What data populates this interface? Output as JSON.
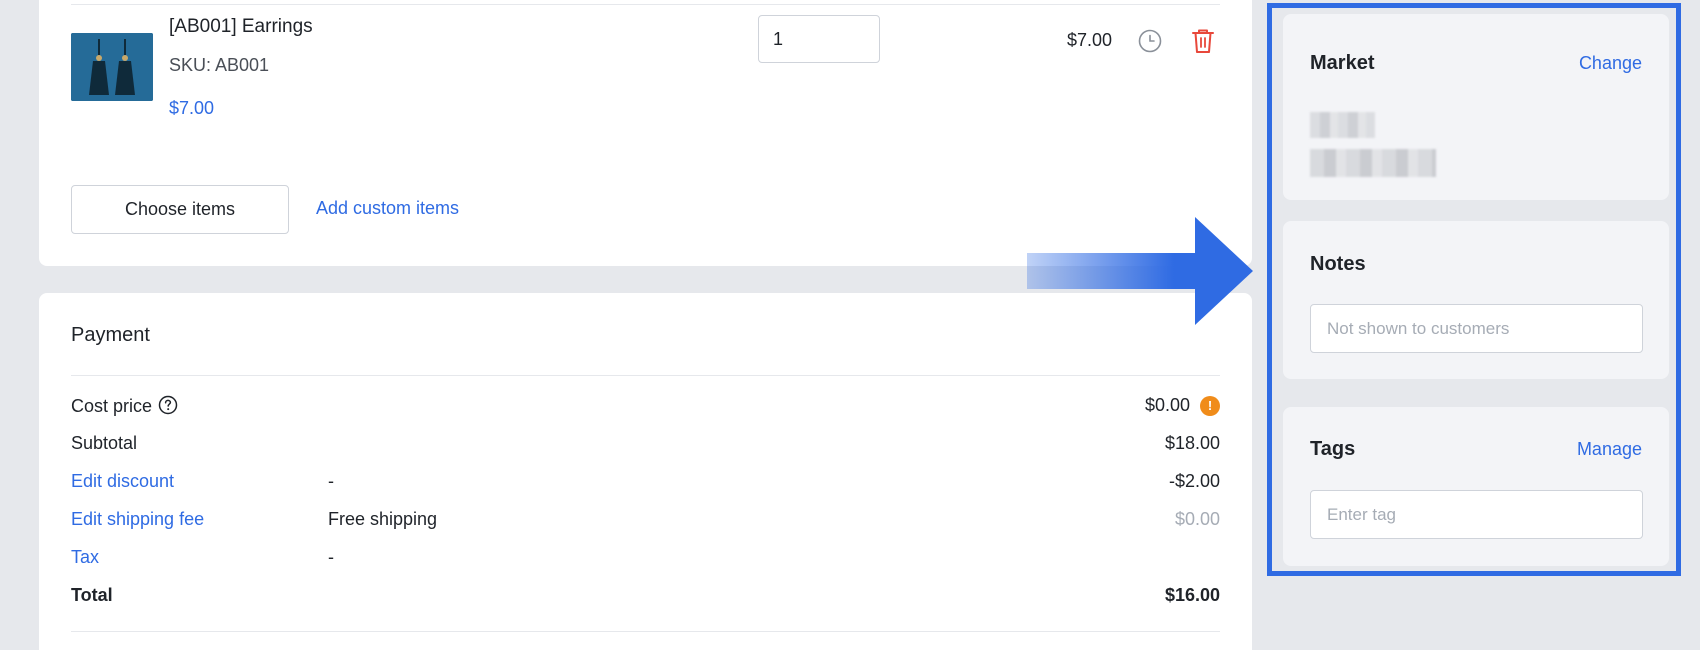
{
  "line_item": {
    "name": "[AB001] Earrings",
    "sku": "SKU: AB001",
    "unit_price": "$7.00",
    "quantity": "1",
    "total": "$7.00"
  },
  "items_actions": {
    "choose_label": "Choose items",
    "add_custom_label": "Add custom items"
  },
  "payment": {
    "title": "Payment",
    "rows": [
      {
        "label": "Cost price",
        "detail": "",
        "value": "$0.00"
      },
      {
        "label": "Subtotal",
        "detail": "",
        "value": "$18.00"
      },
      {
        "label": "Edit discount",
        "detail": "-",
        "value": "-$2.00"
      },
      {
        "label": "Edit shipping fee",
        "detail": "Free shipping",
        "value": "$0.00"
      },
      {
        "label": "Tax",
        "detail": "-",
        "value": ""
      },
      {
        "label": "Total",
        "detail": "",
        "value": "$16.00"
      }
    ],
    "warning_glyph": "!"
  },
  "sidebar": {
    "market": {
      "title": "Market",
      "action": "Change"
    },
    "notes": {
      "title": "Notes",
      "placeholder": "Not shown to customers"
    },
    "tags": {
      "title": "Tags",
      "action": "Manage",
      "placeholder": "Enter tag"
    }
  },
  "colors": {
    "accent": "#2f6be3",
    "danger": "#e8483b",
    "warning": "#f08c1a",
    "highlight_frame": "#2f6be3"
  },
  "icons": [
    "clock-icon",
    "trash-icon",
    "help-circle-icon",
    "warning-icon",
    "pointer-arrow-icon"
  ]
}
